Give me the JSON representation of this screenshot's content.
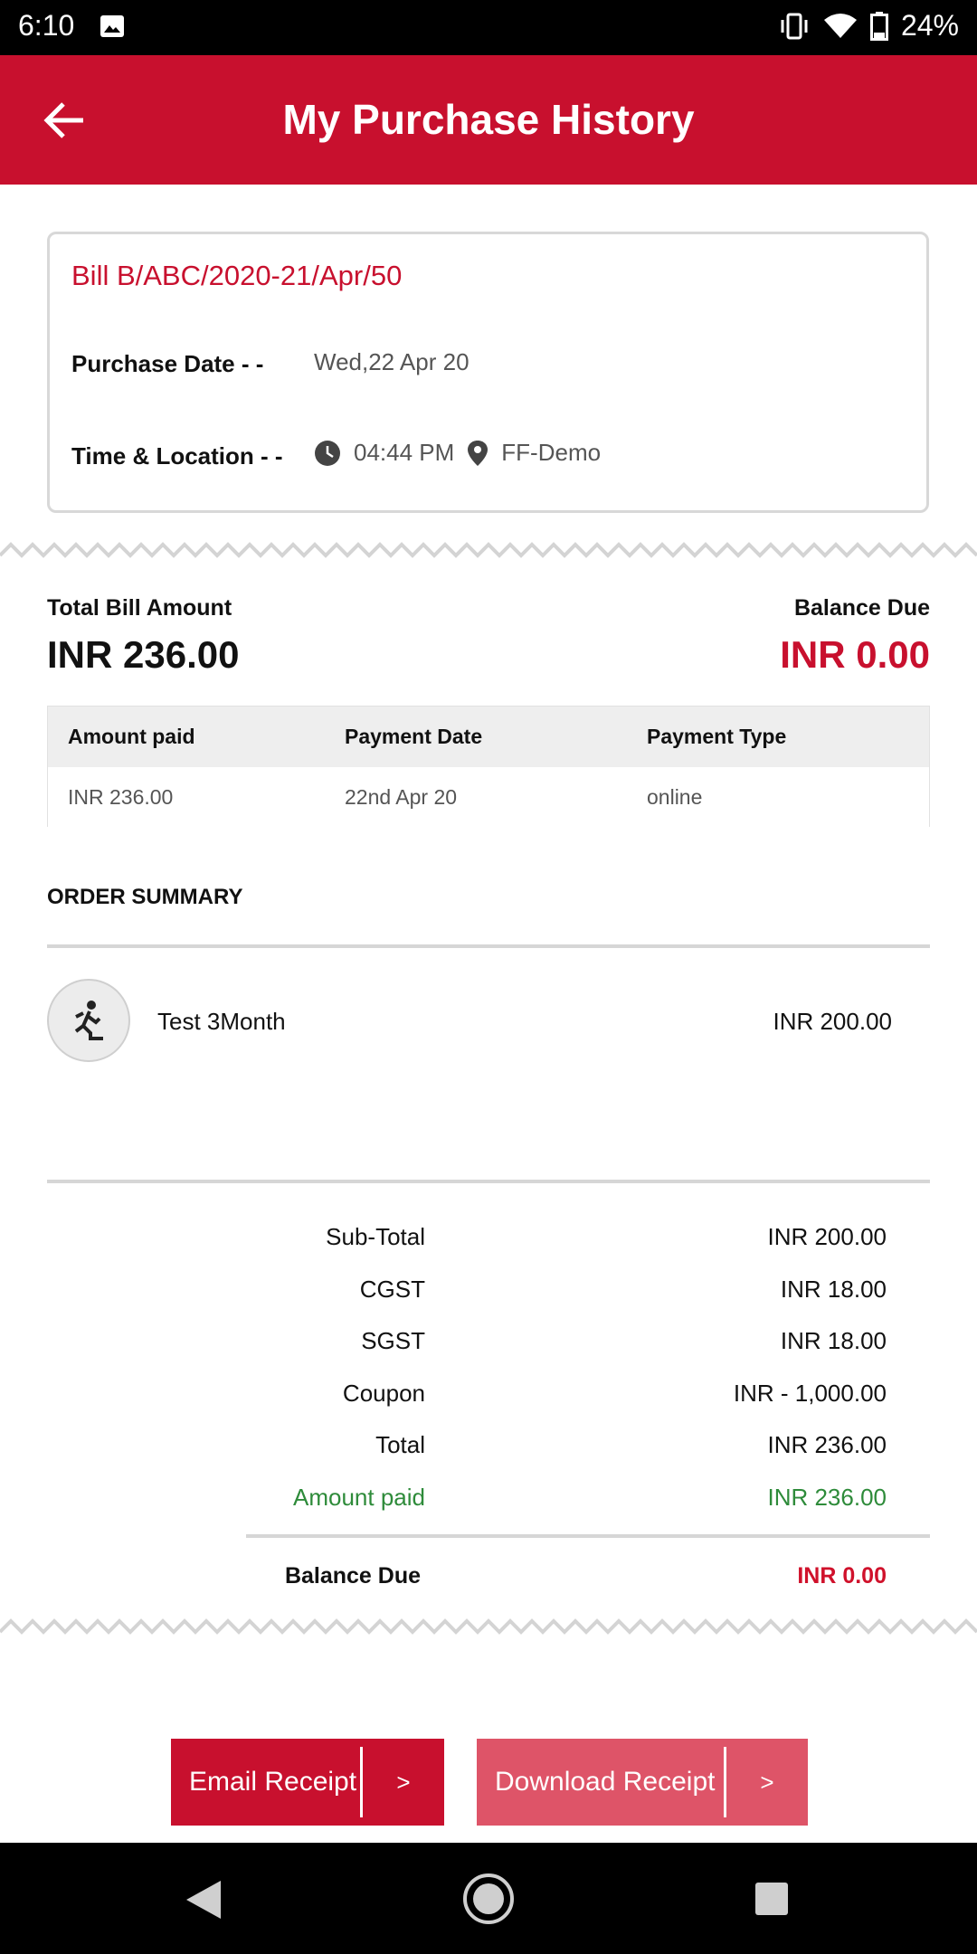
{
  "status_bar": {
    "time": "6:10",
    "battery": "24%",
    "icons": [
      "image-icon",
      "vibrate-icon",
      "wifi-icon",
      "battery-icon"
    ]
  },
  "app_bar": {
    "title": "My Purchase History",
    "back_icon": "arrow-left-icon"
  },
  "bill": {
    "number": "Bill B/ABC/2020-21/Apr/50",
    "purchase_date_label": "Purchase Date - -",
    "purchase_date": "Wed,22 Apr 20",
    "time_location_label": "Time & Location - -",
    "time": "04:44 PM",
    "location": "FF-Demo"
  },
  "totals": {
    "total_bill_label": "Total Bill Amount",
    "total_bill_value": "INR 236.00",
    "balance_due_label": "Balance Due",
    "balance_due_value": "INR 0.00"
  },
  "payments": {
    "headers": [
      "Amount paid",
      "Payment Date",
      "Payment Type"
    ],
    "rows": [
      [
        "INR 236.00",
        "22nd Apr 20",
        "online"
      ]
    ]
  },
  "order_summary": {
    "title": "ORDER SUMMARY",
    "items": [
      {
        "name": "Test 3Month",
        "price": "INR 200.00",
        "icon": "exercise-icon"
      }
    ]
  },
  "summary": {
    "rows": [
      {
        "label": "Sub-Total",
        "value": "INR 200.00"
      },
      {
        "label": "CGST",
        "value": "INR 18.00"
      },
      {
        "label": "SGST",
        "value": "INR 18.00"
      },
      {
        "label": "Coupon",
        "value": "INR - 1,000.00"
      },
      {
        "label": "Total",
        "value": "INR 236.00"
      },
      {
        "label": "Amount paid",
        "value": "INR 236.00"
      }
    ],
    "balance_due_label": "Balance Due",
    "balance_due_value": "INR 0.00"
  },
  "buttons": {
    "email_receipt": "Email Receipt",
    "download_receipt": "Download Receipt",
    "arrow": ">"
  },
  "colors": {
    "brand": "#c8102e",
    "brand_light": "#de5468",
    "paid_green": "#2e8b3a",
    "due_red": "#d0112b"
  }
}
